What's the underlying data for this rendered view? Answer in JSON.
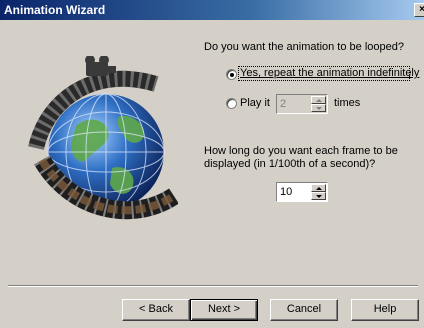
{
  "window": {
    "title": "Animation Wizard",
    "close_glyph": "×"
  },
  "loop_question": "Do you want the animation to be looped?",
  "option_repeat": {
    "label": "Yes, repeat the animation indefinitely",
    "selected": true
  },
  "option_play": {
    "prefix": "Play it",
    "count": "2",
    "suffix": "times",
    "selected": false
  },
  "frame_question_line1": "How long do you want each frame to be",
  "frame_question_line2": "displayed (in 1/100th of a second)?",
  "frame_duration": "10",
  "buttons": {
    "back": "< Back",
    "next": "Next >",
    "cancel": "Cancel",
    "help": "Help"
  },
  "colors": {
    "dialog_bg": "#d4d0c8",
    "title_start": "#0a246a",
    "title_end": "#a6caf0"
  }
}
